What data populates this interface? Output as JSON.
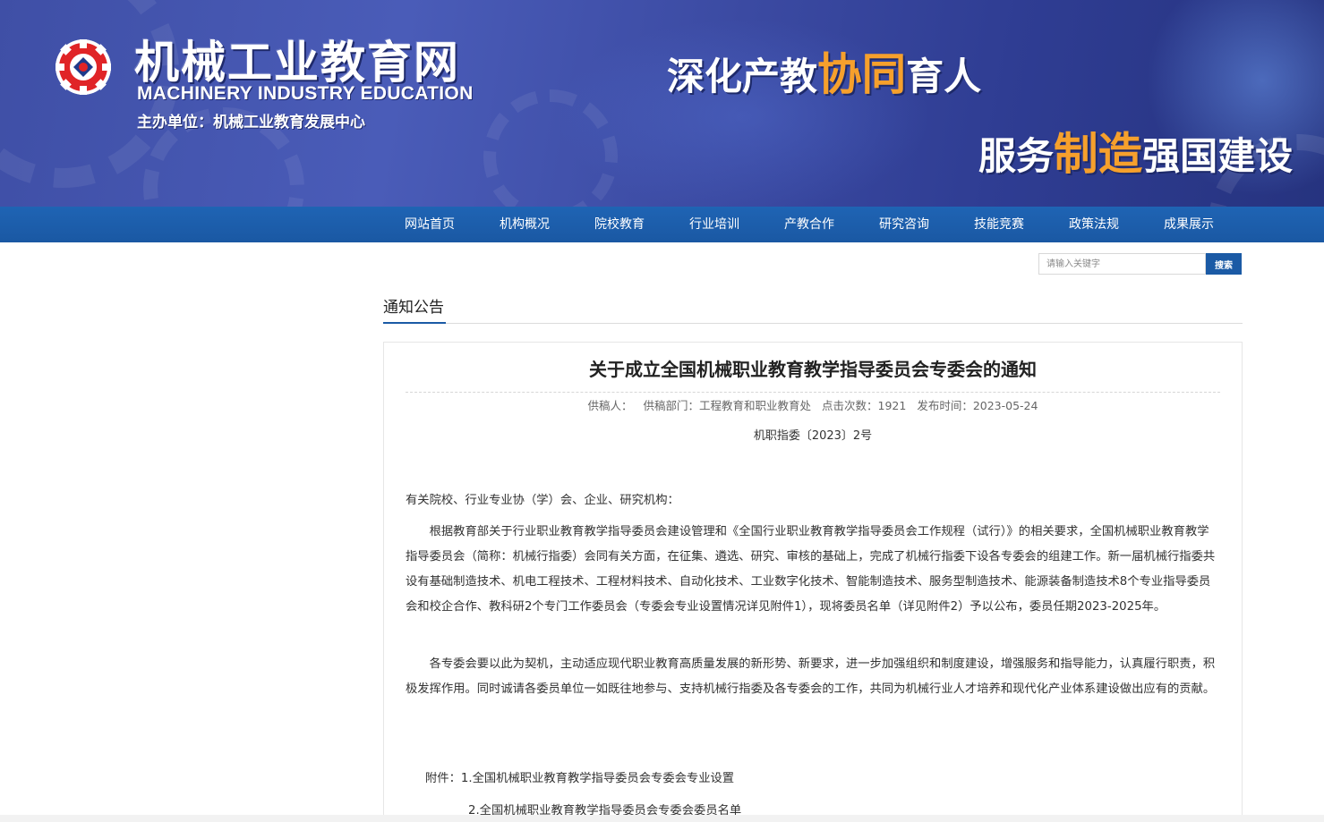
{
  "banner": {
    "site_title": "机械工业教育网",
    "site_subtitle": "MACHINERY INDUSTRY EDUCATION",
    "host_unit": "主办单位：机械工业教育发展中心",
    "slogan1": {
      "pre": "深化产教",
      "highlight": "协同",
      "post": "育人"
    },
    "slogan2": {
      "pre": "服务",
      "highlight": "制造",
      "post": "强国建设"
    },
    "colors": {
      "background": "#3f4fa6",
      "highlight": "#f6a02c",
      "logo_red": "#e02427"
    }
  },
  "nav": {
    "items": [
      {
        "label": "网站首页"
      },
      {
        "label": "机构概况"
      },
      {
        "label": "院校教育"
      },
      {
        "label": "行业培训"
      },
      {
        "label": "产教合作"
      },
      {
        "label": "研究咨询"
      },
      {
        "label": "技能竞赛"
      },
      {
        "label": "政策法规"
      },
      {
        "label": "成果展示"
      }
    ],
    "color": "#1b5aa5"
  },
  "search": {
    "placeholder": "请输入关键字",
    "button_label": "搜索"
  },
  "section": {
    "title": "通知公告"
  },
  "article": {
    "title": "关于成立全国机械职业教育教学指导委员会专委会的通知",
    "meta": {
      "author": "供稿人：",
      "department": "供稿部门：工程教育和职业教育处",
      "views": "点击次数：1921",
      "published": "发布时间：2023-05-24"
    },
    "doc_number": "机职指委〔2023〕2号",
    "salutation": "有关院校、行业专业协（学）会、企业、研究机构：",
    "paragraph1": "根据教育部关于行业职业教育教学指导委员会建设管理和《全国行业职业教育教学指导委员会工作规程（试行）》的相关要求，全国机械职业教育教学指导委员会（简称：机械行指委）会同有关方面，在征集、遴选、研究、审核的基础上，完成了机械行指委下设各专委会的组建工作。新一届机械行指委共设有基础制造技术、机电工程技术、工程材料技术、自动化技术、工业数字化技术、智能制造技术、服务型制造技术、能源装备制造技术8个专业指导委员会和校企合作、教科研2个专门工作委员会（专委会专业设置情况详见附件1），现将委员名单（详见附件2）予以公布，委员任期2023-2025年。",
    "paragraph2": "各专委会要以此为契机，主动适应现代职业教育高质量发展的新形势、新要求，进一步加强组织和制度建设，增强服务和指导能力，认真履行职责，积极发挥作用。同时诚请各委员单位一如既往地参与、支持机械行指委及各专委会的工作，共同为机械行业人才培养和现代化产业体系建设做出应有的贡献。",
    "attachment1": "附件：1.全国机械职业教育教学指导委员会专委会专业设置",
    "attachment2": "2.全国机械职业教育教学指导委员会专委会委员名单"
  }
}
